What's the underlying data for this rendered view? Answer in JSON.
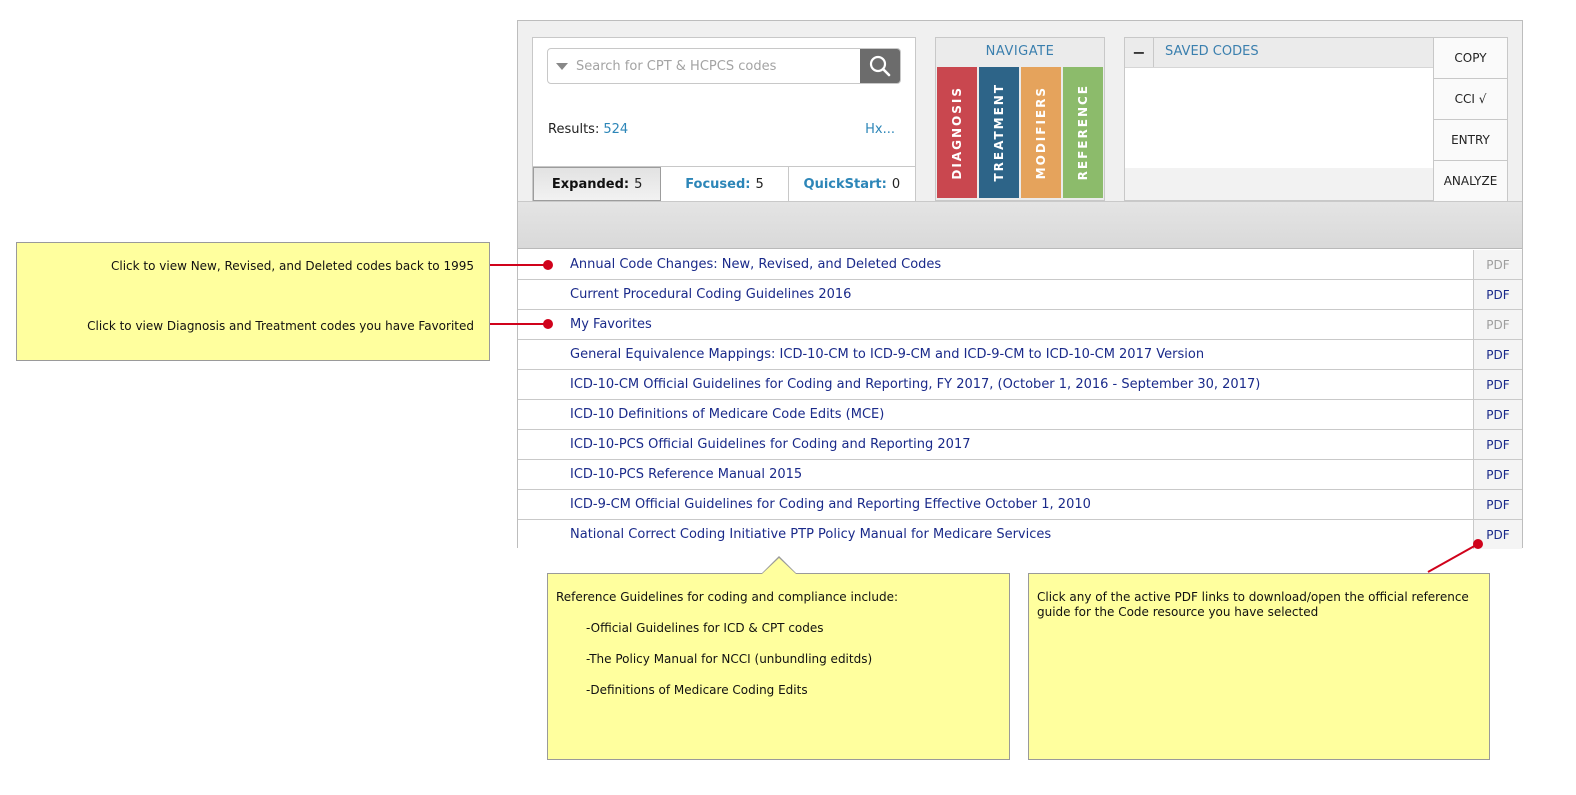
{
  "search": {
    "placeholder": "Search for CPT & HCPCS codes",
    "results_label": "Results:",
    "results_count": "524",
    "hx_link": "Hx..."
  },
  "tabs": [
    {
      "name": "Expanded:",
      "count": "5",
      "active": true
    },
    {
      "name": "Focused:",
      "count": "5",
      "active": false
    },
    {
      "name": "QuickStart:",
      "count": "0",
      "active": false
    }
  ],
  "navigate": {
    "title": "NAVIGATE",
    "tabs": [
      {
        "label": "DIAGNOSIS",
        "color": "#c9474f"
      },
      {
        "label": "TREATMENT",
        "color": "#2d6488"
      },
      {
        "label": "MODIFIERS",
        "color": "#e5a35c"
      },
      {
        "label": "REFERENCE",
        "color": "#8cbb6b"
      }
    ]
  },
  "saved_codes": {
    "collapse_symbol": "−",
    "title": "SAVED CODES",
    "buttons": [
      "COPY",
      "CCI √",
      "ENTRY",
      "ANALYZE"
    ]
  },
  "resources": [
    {
      "title": "Annual Code Changes: New, Revised, and Deleted Codes",
      "pdf": "PDF",
      "pdf_active": false
    },
    {
      "title": "Current Procedural Coding Guidelines 2016",
      "pdf": "PDF",
      "pdf_active": true
    },
    {
      "title": "My Favorites",
      "pdf": "PDF",
      "pdf_active": false
    },
    {
      "title": "General Equivalence Mappings: ICD-10-CM to ICD-9-CM and ICD-9-CM to ICD-10-CM 2017 Version",
      "pdf": "PDF",
      "pdf_active": true
    },
    {
      "title": "ICD-10-CM Official Guidelines for Coding and Reporting, FY 2017, (October 1, 2016 - September 30, 2017)",
      "pdf": "PDF",
      "pdf_active": true
    },
    {
      "title": "ICD-10 Definitions of Medicare Code Edits (MCE)",
      "pdf": "PDF",
      "pdf_active": true
    },
    {
      "title": "ICD-10-PCS Official Guidelines for Coding and Reporting 2017",
      "pdf": "PDF",
      "pdf_active": true
    },
    {
      "title": "ICD-10-PCS Reference Manual 2015",
      "pdf": "PDF",
      "pdf_active": true
    },
    {
      "title": "ICD-9-CM Official Guidelines for Coding and Reporting Effective October 1, 2010",
      "pdf": "PDF",
      "pdf_active": true
    },
    {
      "title": "National Correct Coding Initiative PTP Policy Manual for Medicare Services",
      "pdf": "PDF",
      "pdf_active": true
    }
  ],
  "callouts": {
    "annual_changes": "Click to view New, Revised, and Deleted codes back to 1995",
    "favorites": "Click to view Diagnosis and Treatment codes you have Favorited",
    "reference_intro": "Reference Guidelines for coding and compliance include:",
    "reference_items": [
      "-Official Guidelines for ICD & CPT codes",
      "-The Policy Manual for NCCI (unbundling editds)",
      "-Definitions of Medicare Coding Edits"
    ],
    "pdf_note": "Click any of the active PDF links to download/open the official reference guide for the Code resource you have selected"
  },
  "colors": {
    "accent": "#2d86b8",
    "link": "#1a2a8a",
    "callout_bg": "#ffff9e",
    "connector": "#d0021b"
  }
}
